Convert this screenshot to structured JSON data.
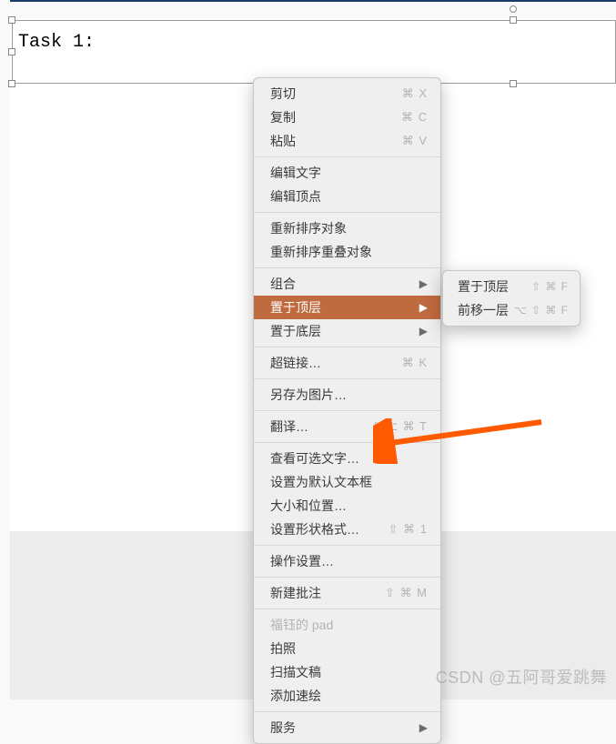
{
  "textbox": {
    "content": "Task 1:"
  },
  "menu": {
    "cut": {
      "label": "剪切",
      "shortcut": "⌘ X"
    },
    "copy": {
      "label": "复制",
      "shortcut": "⌘ C"
    },
    "paste": {
      "label": "粘贴",
      "shortcut": "⌘ V"
    },
    "edit_text": {
      "label": "编辑文字"
    },
    "edit_vertex": {
      "label": "编辑顶点"
    },
    "reorder_obj": {
      "label": "重新排序对象"
    },
    "reorder_overlap": {
      "label": "重新排序重叠对象"
    },
    "group": {
      "label": "组合"
    },
    "bring_front": {
      "label": "置于顶层"
    },
    "send_back": {
      "label": "置于底层"
    },
    "hyperlink": {
      "label": "超链接…",
      "shortcut": "⌘ K"
    },
    "save_as_pic": {
      "label": "另存为图片…"
    },
    "translate": {
      "label": "翻译…",
      "shortcut": "^ ⌥ ⌘ T"
    },
    "alt_text": {
      "label": "查看可选文字…"
    },
    "set_default_textbox": {
      "label": "设置为默认文本框"
    },
    "size_pos": {
      "label": "大小和位置…"
    },
    "format_shape": {
      "label": "设置形状格式…",
      "shortcut": "⇧ ⌘ 1"
    },
    "action_settings": {
      "label": "操作设置…"
    },
    "new_comment": {
      "label": "新建批注",
      "shortcut": "⇧ ⌘ M"
    },
    "pad": {
      "label": "福钰的 pad"
    },
    "take_photo": {
      "label": "拍照"
    },
    "scan_doc": {
      "label": "扫描文稿"
    },
    "add_sketch": {
      "label": "添加速绘"
    },
    "services": {
      "label": "服务"
    }
  },
  "submenu": {
    "bring_to_front": {
      "label": "置于顶层",
      "shortcut": "⇧ ⌘ F"
    },
    "bring_forward": {
      "label": "前移一层",
      "shortcut": "⌥ ⇧ ⌘ F"
    }
  },
  "watermark": "CSDN @五阿哥爱跳舞"
}
